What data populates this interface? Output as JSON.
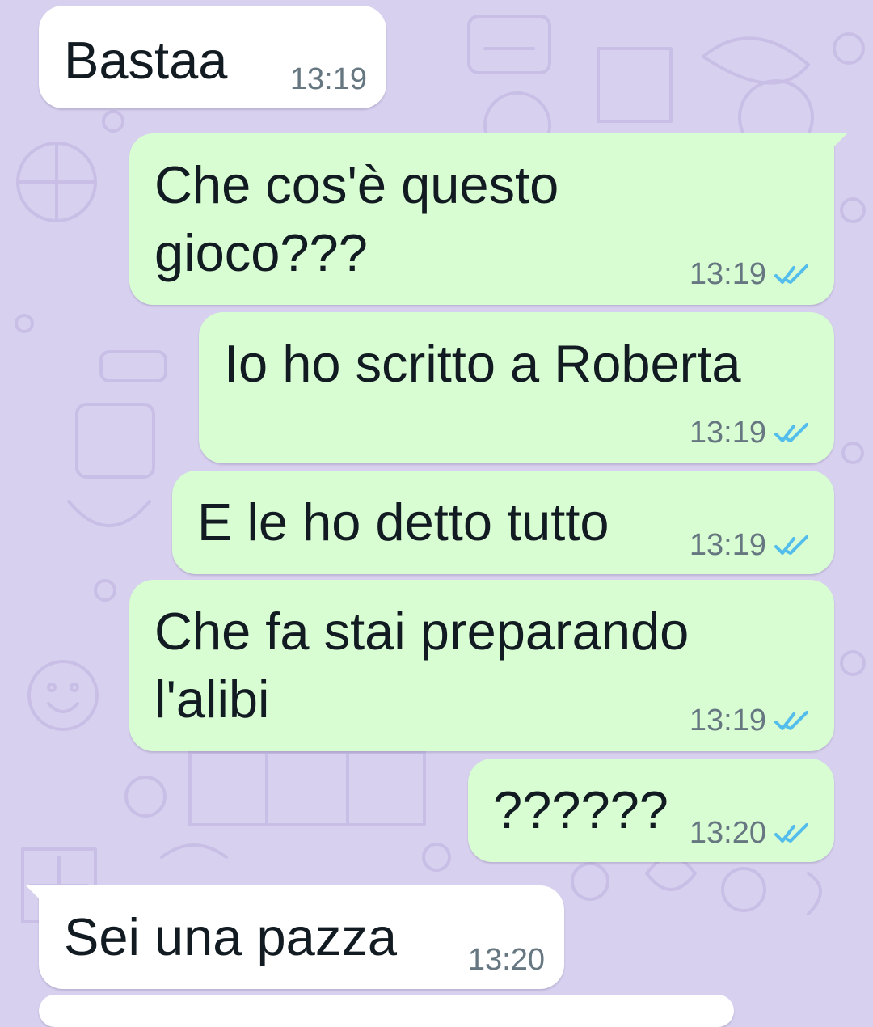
{
  "colors": {
    "wallpaper": "#d8d0ef",
    "incoming_bubble": "#ffffff",
    "outgoing_bubble": "#d9fdd3",
    "text": "#111b21",
    "timestamp": "#667781",
    "read_receipt": "#53bdeb"
  },
  "messages": [
    {
      "direction": "incoming",
      "text": "Bastaa",
      "time": "13:19"
    },
    {
      "direction": "outgoing",
      "text_lines": [
        "Che cos'è questo",
        "gioco???"
      ],
      "time": "13:19",
      "status_icon": "double-check-icon"
    },
    {
      "direction": "outgoing",
      "text": "Io ho scritto a Roberta",
      "time": "13:19",
      "status_icon": "double-check-icon"
    },
    {
      "direction": "outgoing",
      "text": "E le ho detto tutto",
      "time": "13:19",
      "status_icon": "double-check-icon"
    },
    {
      "direction": "outgoing",
      "text_lines": [
        "Che fa stai preparando",
        "l'alibi"
      ],
      "time": "13:19",
      "status_icon": "double-check-icon"
    },
    {
      "direction": "outgoing",
      "text": "??????",
      "time": "13:20",
      "status_icon": "double-check-icon"
    },
    {
      "direction": "incoming",
      "text": "Sei una pazza",
      "time": "13:20"
    }
  ]
}
